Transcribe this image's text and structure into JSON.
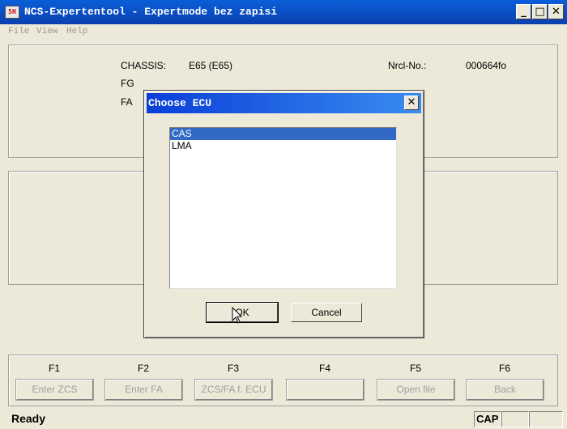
{
  "window": {
    "title": "NCS-Expertentool - Expertmode bez zapisi",
    "icon": "app-icon",
    "icon_glyph": "5H",
    "minimize_glyph": "_",
    "maximize_glyph": "□",
    "close_glyph": "✕"
  },
  "menu": [
    "File",
    "View",
    "Help"
  ],
  "info": {
    "chassis_label": "CHASSIS:",
    "chassis_value": "E65 (E65)",
    "fg_label": "FG",
    "fa_label": "FA",
    "nrcl_label": "Nrcl-No.:",
    "nrcl_value": "000664fo"
  },
  "dialog": {
    "title": "Choose ECU",
    "close_glyph": "✕",
    "items": [
      "CAS",
      "LMA"
    ],
    "selected_index": 0,
    "ok_label": "OK",
    "cancel_label": "Cancel"
  },
  "function_keys": [
    {
      "key": "F1",
      "label": "Enter ZCS"
    },
    {
      "key": "F2",
      "label": "Enter FA"
    },
    {
      "key": "F3",
      "label": "ZCS/FA f. ECU"
    },
    {
      "key": "F4",
      "label": ""
    },
    {
      "key": "F5",
      "label": "Open file"
    },
    {
      "key": "F6",
      "label": "Back"
    }
  ],
  "status": {
    "text": "Ready",
    "cap": "CAP"
  }
}
